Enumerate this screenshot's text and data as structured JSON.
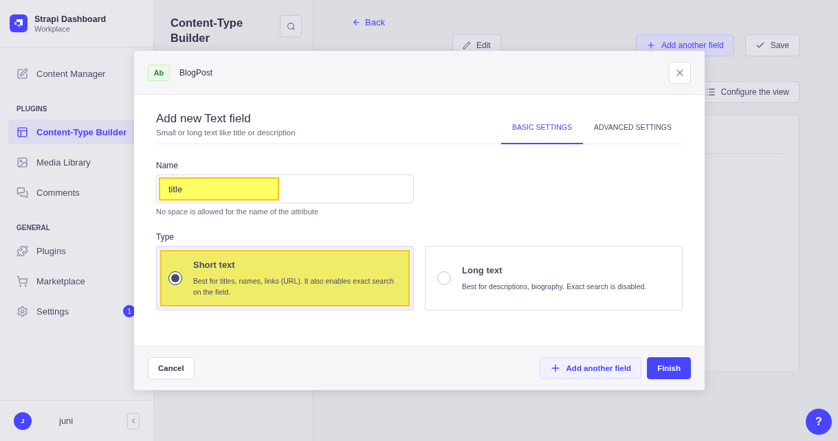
{
  "brand": {
    "title": "Strapi Dashboard",
    "subtitle": "Workplace"
  },
  "nav": [
    {
      "items": [
        {
          "label": "Content Manager",
          "selected": false
        }
      ]
    },
    {
      "heading": "PLUGINS",
      "items": [
        {
          "label": "Content-Type Builder",
          "selected": true
        },
        {
          "label": "Media Library",
          "selected": false
        },
        {
          "label": "Comments",
          "selected": false
        }
      ]
    },
    {
      "heading": "GENERAL",
      "items": [
        {
          "label": "Plugins",
          "selected": false
        },
        {
          "label": "Marketplace",
          "selected": false
        },
        {
          "label": "Settings",
          "selected": false,
          "badge": "1"
        }
      ]
    }
  ],
  "user": {
    "initial": "J",
    "name": "juni"
  },
  "builder": {
    "title": "Content-Type Builder"
  },
  "main": {
    "back": "Back",
    "edit": "Edit",
    "add_field": "Add another field",
    "save": "Save",
    "configure": "Configure the view"
  },
  "modal": {
    "badge": "Ab",
    "type_name": "BlogPost",
    "title": "Add new Text field",
    "subtitle": "Small or long text like title or description",
    "tabs": [
      {
        "label": "BASIC SETTINGS",
        "selected": true
      },
      {
        "label": "ADVANCED SETTINGS",
        "selected": false
      }
    ],
    "name_field": {
      "label": "Name",
      "value": "title",
      "hint": "No space is allowed for the name of the attribute",
      "highlighted": true
    },
    "type_label": "Type",
    "options": [
      {
        "title": "Short text",
        "description": "Best for titles, names, links (URL). It also enables exact search on the field.",
        "selected": true,
        "highlighted": true
      },
      {
        "title": "Long text",
        "description": "Best for descriptions, biography. Exact search is disabled.",
        "selected": false,
        "highlighted": false
      }
    ],
    "cancel": "Cancel",
    "add_field": "Add another field",
    "finish": "Finish"
  },
  "help": "?"
}
